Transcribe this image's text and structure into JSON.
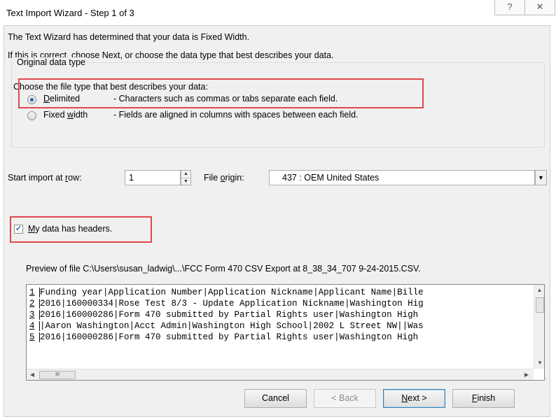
{
  "window": {
    "title": "Text Import Wizard - Step 1 of 3",
    "help_glyph": "?",
    "close_glyph": "✕"
  },
  "intro": {
    "line1": "The Text Wizard has determined that your data is Fixed Width.",
    "line2": "If this is correct, choose Next, or choose the data type that best describes your data."
  },
  "original_data_type": {
    "group_label": "Original data type",
    "prompt": "Choose the file type that best describes your data:",
    "options": [
      {
        "label_pre": "",
        "label_acc": "D",
        "label_post": "elimited",
        "description": "- Characters such as commas or tabs separate each field.",
        "selected": true
      },
      {
        "label_pre": "Fixed ",
        "label_acc": "w",
        "label_post": "idth",
        "description": "- Fields are aligned in columns with spaces between each field.",
        "selected": false
      }
    ]
  },
  "start_row": {
    "label_pre": "Start import at ",
    "label_acc": "r",
    "label_post": "ow:",
    "value": "1"
  },
  "file_origin": {
    "label_pre": "File ",
    "label_acc": "o",
    "label_post": "rigin:",
    "value": "437 : OEM United States"
  },
  "headers_checkbox": {
    "label_acc": "M",
    "label_post": "y data has headers.",
    "checked": true
  },
  "preview": {
    "caption": "Preview of file C:\\Users\\susan_ladwig\\...\\FCC Form 470 CSV Export at 8_38_34_707 9-24-2015.CSV.",
    "lines": [
      {
        "num": "1",
        "text": "Funding year|Application Number|Application Nickname|Applicant Name|Bille"
      },
      {
        "num": "2",
        "text": "2016|160000334|Rose Test 8/3 - Update Application Nickname|Washington Hig"
      },
      {
        "num": "3",
        "text": "2016|160000286|Form 470 submitted by Partial Rights user|Washington High "
      },
      {
        "num": "4",
        "text": "|Aaron Washington|Acct Admin|Washington High School|2002 L Street NW||Was"
      },
      {
        "num": "5",
        "text": "2016|160000286|Form 470 submitted by Partial Rights user|Washington High "
      }
    ],
    "hthumb_glyph": "III"
  },
  "buttons": {
    "cancel": "Cancel",
    "back": "< Back",
    "next_acc": "N",
    "next_post": "ext >",
    "finish_acc": "F",
    "finish_post": "inish"
  },
  "colors": {
    "highlight": "#e0484b",
    "accent": "#2a63b3"
  }
}
